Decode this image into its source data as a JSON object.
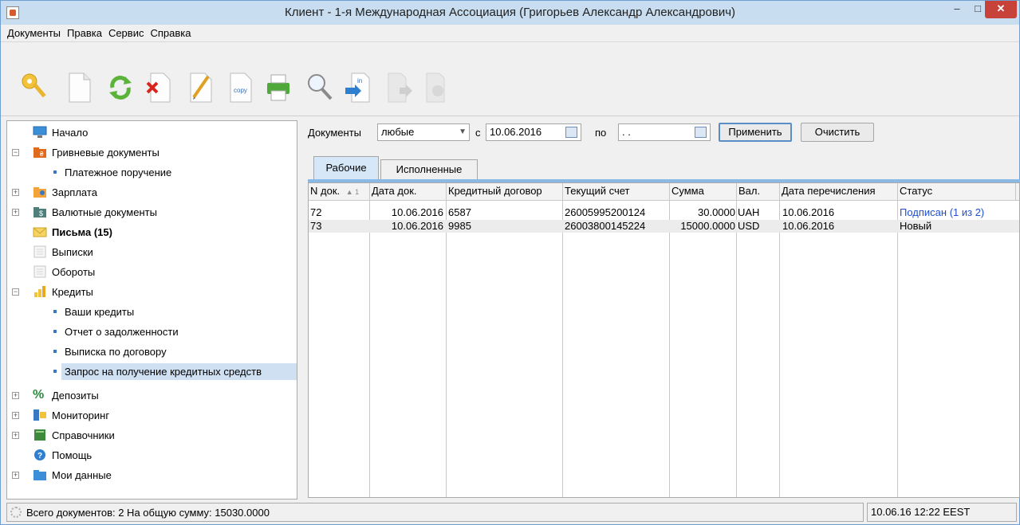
{
  "window": {
    "title": "Клиент - 1-я Международная Ассоциация (Григорьев Александр Александрович)",
    "minimize": "–",
    "maximize": "□",
    "close": "✕"
  },
  "menu": [
    "Документы",
    "Правка",
    "Сервис",
    "Справка"
  ],
  "toolbar": {
    "buttons": [
      "key-icon",
      "new-document-icon",
      "refresh-icon",
      "delete-icon",
      "edit-icon",
      "copy-icon",
      "print-icon",
      "search-icon",
      "import-icon",
      "export-icon",
      "export-alt-icon",
      "archive-icon"
    ],
    "copy_label": "copy",
    "import_label": "in"
  },
  "tree": [
    {
      "label": "Начало",
      "icon": "monitor-icon"
    },
    {
      "label": "Гривневые документы",
      "icon": "folder-uah-icon",
      "expander": "minus"
    },
    {
      "label": "Платежное поручение",
      "child": true
    },
    {
      "label": "Зарплата",
      "icon": "folder-user-icon",
      "expander": "plus"
    },
    {
      "label": "Валютные документы",
      "icon": "folder-dollar-icon",
      "expander": "plus"
    },
    {
      "label": "Письма (15)",
      "icon": "envelope-icon",
      "bold": true
    },
    {
      "label": "Выписки",
      "icon": "document-icon"
    },
    {
      "label": "Обороты",
      "icon": "document-icon"
    },
    {
      "label": "Кредиты",
      "icon": "bar-chart-icon",
      "expander": "minus"
    },
    {
      "label": "Ваши кредиты",
      "child": true
    },
    {
      "label": "Отчет о задолженности",
      "child": true
    },
    {
      "label": "Выписка по договору",
      "child": true
    },
    {
      "label": "Запрос на получение кредитных средств",
      "child": true,
      "selected": true
    },
    {
      "label": "Депозиты",
      "icon": "percent-icon",
      "expander": "plus"
    },
    {
      "label": "Мониторинг",
      "icon": "monitoring-icon",
      "expander": "plus"
    },
    {
      "label": "Справочники",
      "icon": "book-icon",
      "expander": "plus"
    },
    {
      "label": "Помощь",
      "icon": "help-icon"
    },
    {
      "label": "Мои данные",
      "icon": "folder-icon",
      "expander": "plus"
    }
  ],
  "filter": {
    "documents_label": "Документы",
    "documents_value": "любые",
    "from_label": "с",
    "from_date": "10.06.2016",
    "to_label": "по",
    "to_date": " .  . ",
    "apply": "Применить",
    "clear": "Очистить"
  },
  "tabs": [
    "Рабочие",
    "Исполненные"
  ],
  "table": {
    "columns": [
      "N док.",
      "Дата док.",
      "Кредитный договор",
      "Текущий счет",
      "Сумма",
      "Вал.",
      "Дата перечисления",
      "Статус"
    ],
    "sort_indicator": "▲ 1",
    "rows": [
      [
        "72",
        "10.06.2016",
        "6587",
        "26005995200124",
        "30.0000",
        "UAH",
        "10.06.2016",
        "Подписан (1 из 2)"
      ],
      [
        "73",
        "10.06.2016",
        "9985",
        "26003800145224",
        "15000.0000",
        "USD",
        "10.06.2016",
        "Новый"
      ]
    ]
  },
  "statusbar": {
    "summary": "Всего документов: 2 На общую сумму: 15030.0000",
    "datetime": "10.06.16 12:22 EEST"
  }
}
